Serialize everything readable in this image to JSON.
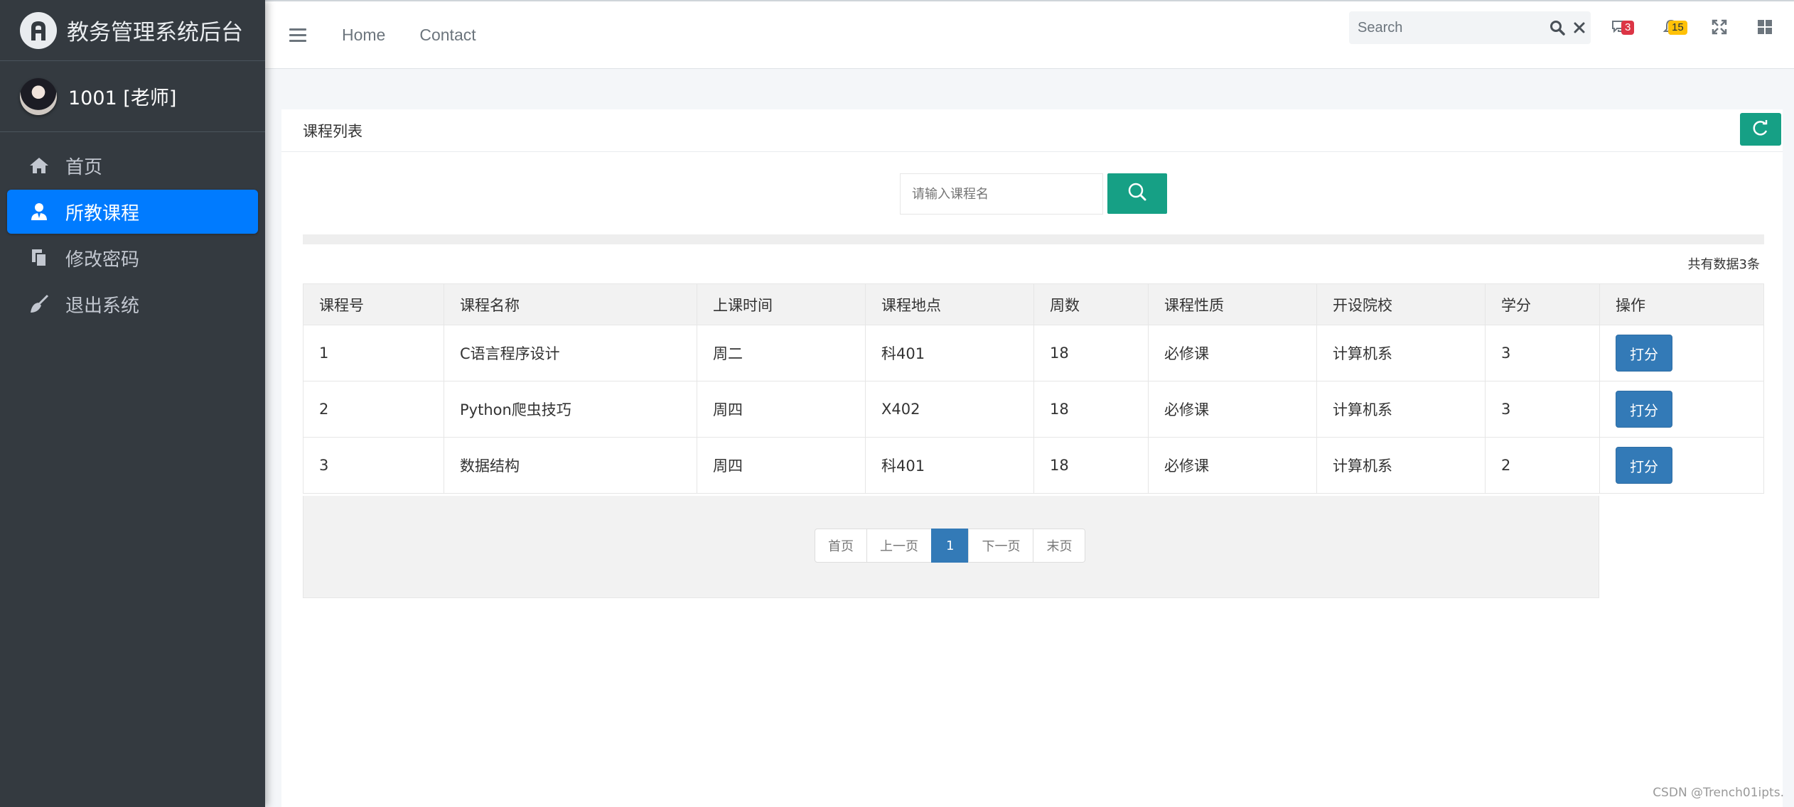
{
  "brand": {
    "title": "教务管理系统后台"
  },
  "user": {
    "name": "1001  [老师]"
  },
  "sidebar": {
    "items": [
      {
        "label": "首页",
        "icon": "home-icon"
      },
      {
        "label": "所教课程",
        "icon": "user-icon",
        "active": true
      },
      {
        "label": "修改密码",
        "icon": "copy-icon"
      },
      {
        "label": "退出系统",
        "icon": "broom-icon"
      }
    ]
  },
  "navbar": {
    "links": [
      "Home",
      "Contact"
    ],
    "search_placeholder": "Search",
    "messages_count": "3",
    "notifications_count": "15"
  },
  "card": {
    "title": "课程列表",
    "search_placeholder": "请输入课程名",
    "total": "共有数据3条"
  },
  "table": {
    "headers": [
      "课程号",
      "课程名称",
      "上课时间",
      "课程地点",
      "周数",
      "课程性质",
      "开设院校",
      "学分",
      "操作"
    ],
    "rows": [
      [
        "1",
        "C语言程序设计",
        "周二",
        "科401",
        "18",
        "必修课",
        "计算机系",
        "3",
        "打分"
      ],
      [
        "2",
        "Python爬虫技巧",
        "周四",
        "X402",
        "18",
        "必修课",
        "计算机系",
        "3",
        "打分"
      ],
      [
        "3",
        "数据结构",
        "周四",
        "科401",
        "18",
        "必修课",
        "计算机系",
        "2",
        "打分"
      ]
    ]
  },
  "pagination": {
    "first": "首页",
    "prev": "上一页",
    "current": "1",
    "next": "下一页",
    "last": "末页"
  },
  "watermark": "CSDN @Trench01ipts.",
  "colors": {
    "accent": "#007bff",
    "teal": "#16a085",
    "grade": "#337ab7",
    "sidebar": "#343a40"
  }
}
